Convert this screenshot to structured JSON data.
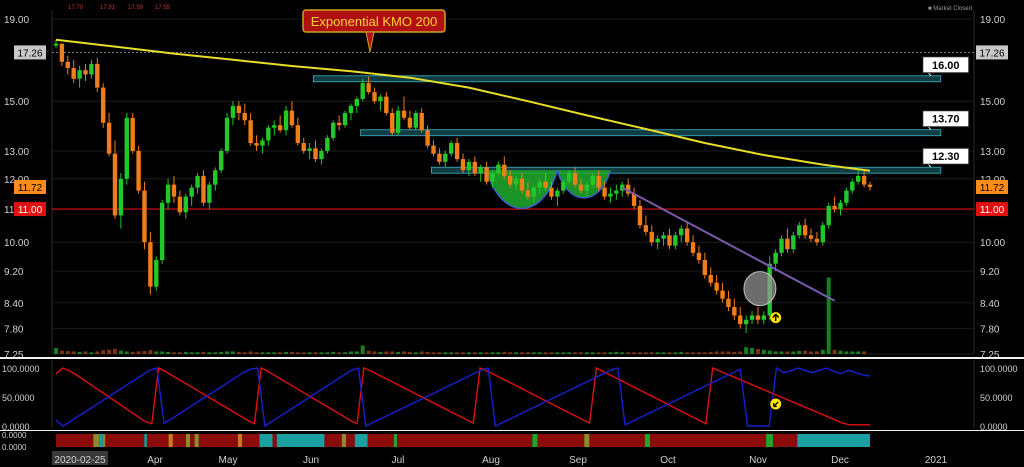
{
  "header": {
    "legend_values": [
      "17.70",
      "17.91",
      "17.59",
      "17.55"
    ],
    "market_status": "Market Closed"
  },
  "chart_data": {
    "type": "candlestick",
    "price_axis": {
      "ticks": [
        "19.00",
        "15.00",
        "13.00",
        "12.00",
        "11.00",
        "10.00",
        "9.20",
        "8.40",
        "7.80",
        "7.25"
      ],
      "scale": "log",
      "ylim": [
        7.25,
        19.5
      ]
    },
    "price_markers": [
      {
        "value": "17.26",
        "color": "#c8c8c8",
        "text_color": "#000000"
      },
      {
        "value": "11.72",
        "color": "#ff8c1a",
        "text_color": "#000000"
      },
      {
        "value": "11.00",
        "color": "#e01010",
        "text_color": "#ffffff"
      }
    ],
    "time_axis": [
      "2020-02-25",
      "Apr",
      "May",
      "Jun",
      "Jul",
      "Aug",
      "Sep",
      "Oct",
      "Nov",
      "Dec",
      "2021"
    ],
    "annotation": "Exponential KMO 200",
    "resistance_labels": [
      "16.00",
      "13.70",
      "12.30"
    ],
    "support_line": 11.0,
    "previous_close_line": 17.26,
    "colors": {
      "up": "#22c72a",
      "down": "#f07d1a",
      "kmo": "#e8de2a",
      "zone": "#1b6f7a",
      "cup": "#1fa32b"
    },
    "candles": [
      [
        17.6,
        17.9,
        17.5,
        17.7
      ],
      [
        17.7,
        17.7,
        16.6,
        16.8
      ],
      [
        16.8,
        17.1,
        16.2,
        16.5
      ],
      [
        16.5,
        16.9,
        15.8,
        16.0
      ],
      [
        16.0,
        16.6,
        15.6,
        16.4
      ],
      [
        16.4,
        16.7,
        15.9,
        16.2
      ],
      [
        16.2,
        16.9,
        16.0,
        16.7
      ],
      [
        16.7,
        17.0,
        15.4,
        15.6
      ],
      [
        15.6,
        15.8,
        13.9,
        14.1
      ],
      [
        14.1,
        14.5,
        12.8,
        12.9
      ],
      [
        12.9,
        13.4,
        10.7,
        10.8
      ],
      [
        10.8,
        12.2,
        10.4,
        12.0
      ],
      [
        12.0,
        14.5,
        11.8,
        14.3
      ],
      [
        14.3,
        14.5,
        12.9,
        13.0
      ],
      [
        13.0,
        13.2,
        11.5,
        11.6
      ],
      [
        11.6,
        11.9,
        9.8,
        10.0
      ],
      [
        10.0,
        10.3,
        8.6,
        8.8
      ],
      [
        8.8,
        9.6,
        8.7,
        9.5
      ],
      [
        9.5,
        11.3,
        9.4,
        11.2
      ],
      [
        11.2,
        12.0,
        11.0,
        11.8
      ],
      [
        11.8,
        12.1,
        11.2,
        11.4
      ],
      [
        11.4,
        11.6,
        10.8,
        10.9
      ],
      [
        10.9,
        11.5,
        10.7,
        11.4
      ],
      [
        11.4,
        11.8,
        11.1,
        11.7
      ],
      [
        11.7,
        12.2,
        11.5,
        12.1
      ],
      [
        12.1,
        12.3,
        11.1,
        11.2
      ],
      [
        11.2,
        11.9,
        11.0,
        11.8
      ],
      [
        11.8,
        12.4,
        11.6,
        12.3
      ],
      [
        12.3,
        13.1,
        12.2,
        13.0
      ],
      [
        13.0,
        14.5,
        12.9,
        14.3
      ],
      [
        14.3,
        15.0,
        14.0,
        14.8
      ],
      [
        14.8,
        15.0,
        14.2,
        14.5
      ],
      [
        14.5,
        14.9,
        14.0,
        14.2
      ],
      [
        14.2,
        14.5,
        13.2,
        13.3
      ],
      [
        13.3,
        13.6,
        13.0,
        13.2
      ],
      [
        13.2,
        13.5,
        12.9,
        13.4
      ],
      [
        13.4,
        14.0,
        13.2,
        13.9
      ],
      [
        13.9,
        14.2,
        13.6,
        14.0
      ],
      [
        14.0,
        14.4,
        13.7,
        13.8
      ],
      [
        13.8,
        14.8,
        13.6,
        14.6
      ],
      [
        14.6,
        15.0,
        13.9,
        14.0
      ],
      [
        14.0,
        14.3,
        13.2,
        13.3
      ],
      [
        13.3,
        13.5,
        12.9,
        13.0
      ],
      [
        13.0,
        13.3,
        12.7,
        13.1
      ],
      [
        13.1,
        13.4,
        12.6,
        12.7
      ],
      [
        12.7,
        13.1,
        12.5,
        13.0
      ],
      [
        13.0,
        13.6,
        12.9,
        13.5
      ],
      [
        13.5,
        14.2,
        13.4,
        14.1
      ],
      [
        14.1,
        14.4,
        13.8,
        14.0
      ],
      [
        14.0,
        14.6,
        13.9,
        14.5
      ],
      [
        14.5,
        14.9,
        14.2,
        14.8
      ],
      [
        14.8,
        15.2,
        14.5,
        15.1
      ],
      [
        15.1,
        16.0,
        15.0,
        15.8
      ],
      [
        15.8,
        16.1,
        15.3,
        15.4
      ],
      [
        15.4,
        15.6,
        14.9,
        15.0
      ],
      [
        15.0,
        15.3,
        14.6,
        15.2
      ],
      [
        15.2,
        15.4,
        14.4,
        14.5
      ],
      [
        14.5,
        14.7,
        13.6,
        13.7
      ],
      [
        13.7,
        14.8,
        13.6,
        14.6
      ],
      [
        14.6,
        15.2,
        14.2,
        14.3
      ],
      [
        14.3,
        14.6,
        13.8,
        13.9
      ],
      [
        13.9,
        14.6,
        13.8,
        14.5
      ],
      [
        14.5,
        14.7,
        13.7,
        13.8
      ],
      [
        13.8,
        14.0,
        13.1,
        13.2
      ],
      [
        13.2,
        13.4,
        12.8,
        12.9
      ],
      [
        12.9,
        13.1,
        12.5,
        12.6
      ],
      [
        12.6,
        13.0,
        12.4,
        12.9
      ],
      [
        12.9,
        13.4,
        12.8,
        13.3
      ],
      [
        13.3,
        13.5,
        12.6,
        12.7
      ],
      [
        12.7,
        12.9,
        12.2,
        12.3
      ],
      [
        12.3,
        12.7,
        12.1,
        12.6
      ],
      [
        12.6,
        12.8,
        12.1,
        12.2
      ],
      [
        12.2,
        12.5,
        11.9,
        12.4
      ],
      [
        12.4,
        12.6,
        11.8,
        11.9
      ],
      [
        11.9,
        12.3,
        11.7,
        12.2
      ],
      [
        12.2,
        12.6,
        12.1,
        12.5
      ],
      [
        12.5,
        12.8,
        12.0,
        12.1
      ],
      [
        12.1,
        12.3,
        11.7,
        11.8
      ],
      [
        11.8,
        12.1,
        11.6,
        12.0
      ],
      [
        12.0,
        12.2,
        11.5,
        11.6
      ],
      [
        11.6,
        11.9,
        11.3,
        11.4
      ],
      [
        11.4,
        11.8,
        11.2,
        11.7
      ],
      [
        11.7,
        12.0,
        11.5,
        11.9
      ],
      [
        11.9,
        12.2,
        11.6,
        11.7
      ],
      [
        11.7,
        11.9,
        11.3,
        11.4
      ],
      [
        11.4,
        11.7,
        11.1,
        11.6
      ],
      [
        11.6,
        12.0,
        11.5,
        11.9
      ],
      [
        11.9,
        12.3,
        11.8,
        12.2
      ],
      [
        12.2,
        12.4,
        11.7,
        11.8
      ],
      [
        11.8,
        12.0,
        11.5,
        11.6
      ],
      [
        11.6,
        11.9,
        11.4,
        11.8
      ],
      [
        11.8,
        12.2,
        11.7,
        12.1
      ],
      [
        12.1,
        12.3,
        11.6,
        11.7
      ],
      [
        11.7,
        11.9,
        11.3,
        11.4
      ],
      [
        11.4,
        11.7,
        11.2,
        11.5
      ],
      [
        11.5,
        11.8,
        11.3,
        11.6
      ],
      [
        11.6,
        11.9,
        11.4,
        11.8
      ],
      [
        11.8,
        12.0,
        11.4,
        11.5
      ],
      [
        11.5,
        11.7,
        11.0,
        11.1
      ],
      [
        11.1,
        11.3,
        10.4,
        10.5
      ],
      [
        10.5,
        10.8,
        10.2,
        10.3
      ],
      [
        10.3,
        10.5,
        9.9,
        10.0
      ],
      [
        10.0,
        10.2,
        9.8,
        10.1
      ],
      [
        10.1,
        10.3,
        9.9,
        10.2
      ],
      [
        10.2,
        10.4,
        9.8,
        9.9
      ],
      [
        9.9,
        10.3,
        9.8,
        10.2
      ],
      [
        10.2,
        10.5,
        10.0,
        10.4
      ],
      [
        10.4,
        10.6,
        9.9,
        10.0
      ],
      [
        10.0,
        10.2,
        9.6,
        9.7
      ],
      [
        9.7,
        9.9,
        9.4,
        9.5
      ],
      [
        9.5,
        9.7,
        9.0,
        9.1
      ],
      [
        9.1,
        9.3,
        8.8,
        8.9
      ],
      [
        8.9,
        9.1,
        8.6,
        8.7
      ],
      [
        8.7,
        8.9,
        8.4,
        8.5
      ],
      [
        8.5,
        8.7,
        8.2,
        8.3
      ],
      [
        8.3,
        8.5,
        8.0,
        8.1
      ],
      [
        8.1,
        8.3,
        7.8,
        7.9
      ],
      [
        7.9,
        8.1,
        7.7,
        8.0
      ],
      [
        8.0,
        8.2,
        7.9,
        8.1
      ],
      [
        8.1,
        8.3,
        7.9,
        8.0
      ],
      [
        8.0,
        8.2,
        7.9,
        8.1
      ],
      [
        8.1,
        9.6,
        8.0,
        9.4
      ],
      [
        9.4,
        9.8,
        9.2,
        9.7
      ],
      [
        9.7,
        10.2,
        9.6,
        10.1
      ],
      [
        10.1,
        10.4,
        9.7,
        9.8
      ],
      [
        9.8,
        10.3,
        9.7,
        10.2
      ],
      [
        10.2,
        10.6,
        10.1,
        10.5
      ],
      [
        10.5,
        10.7,
        10.1,
        10.2
      ],
      [
        10.2,
        10.4,
        10.0,
        10.1
      ],
      [
        10.1,
        10.3,
        9.9,
        10.0
      ],
      [
        10.0,
        10.6,
        9.9,
        10.5
      ],
      [
        10.5,
        11.2,
        10.4,
        11.1
      ],
      [
        11.1,
        11.4,
        10.9,
        11.0
      ],
      [
        11.0,
        11.3,
        10.8,
        11.2
      ],
      [
        11.2,
        11.7,
        11.1,
        11.6
      ],
      [
        11.6,
        12.0,
        11.5,
        11.9
      ],
      [
        11.9,
        12.3,
        11.8,
        12.1
      ],
      [
        12.1,
        12.3,
        11.7,
        11.8
      ],
      [
        11.8,
        11.9,
        11.6,
        11.72
      ]
    ],
    "volume": [
      0.7,
      0.4,
      0.35,
      0.3,
      0.25,
      0.3,
      0.2,
      0.3,
      0.45,
      0.5,
      0.6,
      0.4,
      0.3,
      0.25,
      0.3,
      0.35,
      0.45,
      0.3,
      0.3,
      0.25,
      0.2,
      0.2,
      0.25,
      0.2,
      0.2,
      0.25,
      0.2,
      0.2,
      0.25,
      0.3,
      0.3,
      0.25,
      0.2,
      0.3,
      0.2,
      0.2,
      0.2,
      0.2,
      0.2,
      0.25,
      0.25,
      0.2,
      0.2,
      0.2,
      0.2,
      0.2,
      0.2,
      0.25,
      0.2,
      0.2,
      0.3,
      0.3,
      1.0,
      0.4,
      0.3,
      0.25,
      0.3,
      0.3,
      0.25,
      0.3,
      0.25,
      0.2,
      0.3,
      0.25,
      0.2,
      0.2,
      0.2,
      0.2,
      0.2,
      0.2,
      0.2,
      0.2,
      0.2,
      0.2,
      0.2,
      0.2,
      0.25,
      0.2,
      0.2,
      0.2,
      0.2,
      0.2,
      0.2,
      0.2,
      0.2,
      0.2,
      0.2,
      0.2,
      0.2,
      0.2,
      0.2,
      0.2,
      0.2,
      0.2,
      0.2,
      0.25,
      0.2,
      0.2,
      0.2,
      0.2,
      0.2,
      0.2,
      0.2,
      0.2,
      0.2,
      0.2,
      0.25,
      0.2,
      0.2,
      0.2,
      0.2,
      0.25,
      0.3,
      0.3,
      0.3,
      0.25,
      0.3,
      0.8,
      0.7,
      0.6,
      0.5,
      0.4,
      0.3,
      0.3,
      0.3,
      0.3,
      0.35,
      0.4,
      0.3,
      0.3,
      0.5,
      9.0,
      0.5,
      0.4,
      0.3,
      0.3,
      0.3,
      0.3
    ],
    "oscillator": {
      "ticks": [
        "100.0000",
        "50.0000",
        "0.0000"
      ],
      "series": [
        {
          "color": "#e01010",
          "values": [
            90,
            100,
            95,
            88,
            80,
            72,
            64,
            56,
            48,
            40,
            32,
            24,
            16,
            8,
            4,
            100,
            94,
            87,
            80,
            73,
            66,
            59,
            52,
            45,
            38,
            31,
            24,
            17,
            10,
            4,
            100,
            94,
            87,
            80,
            73,
            66,
            59,
            52,
            45,
            38,
            31,
            24,
            17,
            10,
            4,
            100,
            95,
            89,
            83,
            77,
            71,
            65,
            59,
            53,
            47,
            41,
            35,
            29,
            23,
            17,
            11,
            5,
            100,
            95,
            89,
            83,
            77,
            71,
            65,
            59,
            53,
            47,
            41,
            35,
            29,
            23,
            17,
            11,
            5,
            100,
            94,
            88,
            82,
            76,
            70,
            64,
            58,
            52,
            46,
            40,
            34,
            28,
            22,
            16,
            10,
            4,
            100,
            95,
            90,
            85,
            80,
            75,
            70,
            65,
            60,
            55,
            50,
            45,
            40,
            35,
            30,
            25,
            20,
            15,
            10,
            5,
            2,
            2,
            2,
            2
          ]
        },
        {
          "color": "#1820d0",
          "values": [
            10,
            0,
            8,
            16,
            24,
            32,
            40,
            48,
            56,
            64,
            72,
            80,
            88,
            96,
            100,
            5,
            12,
            20,
            28,
            36,
            44,
            52,
            60,
            68,
            76,
            84,
            92,
            98,
            100,
            0,
            8,
            16,
            24,
            32,
            40,
            48,
            56,
            64,
            72,
            80,
            88,
            96,
            100,
            0,
            6,
            12,
            18,
            24,
            30,
            36,
            42,
            48,
            54,
            60,
            66,
            72,
            78,
            84,
            90,
            96,
            100,
            0,
            6,
            12,
            18,
            24,
            30,
            36,
            42,
            48,
            54,
            60,
            66,
            72,
            78,
            84,
            90,
            96,
            100,
            2,
            8,
            14,
            20,
            26,
            32,
            38,
            44,
            50,
            56,
            62,
            68,
            74,
            80,
            86,
            92,
            98,
            0,
            0,
            0,
            0,
            100,
            92,
            95,
            100,
            96,
            92,
            96,
            100,
            94,
            90,
            96,
            92,
            88,
            86
          ]
        }
      ]
    },
    "ribbon_ticks": [
      "0.0000",
      "0.0000"
    ],
    "ribbon_segments": [
      [
        "#8b0a0a",
        0,
        0.43
      ],
      [
        "#8b8b2a",
        0.43,
        0.5
      ],
      [
        "#1aa0a0",
        0.5,
        0.54
      ],
      [
        "#8b8b2a",
        0.54,
        0.57
      ],
      [
        "#8b0a0a",
        0.57,
        1.02
      ],
      [
        "#1aa0a0",
        1.02,
        1.05
      ],
      [
        "#8b0a0a",
        1.05,
        1.3
      ],
      [
        "#c87a1a",
        1.3,
        1.35
      ],
      [
        "#8b0a0a",
        1.35,
        1.5
      ],
      [
        "#8b8b2a",
        1.5,
        1.55
      ],
      [
        "#8b0a0a",
        1.55,
        1.6
      ],
      [
        "#8b8b2a",
        1.6,
        1.65
      ],
      [
        "#8b0a0a",
        1.65,
        2.1
      ],
      [
        "#c87a1a",
        2.1,
        2.15
      ],
      [
        "#8b0a0a",
        2.15,
        2.35
      ],
      [
        "#1aa0a0",
        2.35,
        2.5
      ],
      [
        "#8b0a0a",
        2.5,
        2.55
      ],
      [
        "#1aa0a0",
        2.55,
        3.1
      ],
      [
        "#8b0a0a",
        3.1,
        3.3
      ],
      [
        "#8b8b2a",
        3.3,
        3.35
      ],
      [
        "#8b0a0a",
        3.35,
        3.45
      ],
      [
        "#1aa0a0",
        3.45,
        3.6
      ],
      [
        "#8b0a0a",
        3.6,
        3.9
      ],
      [
        "#1fa32b",
        3.9,
        3.94
      ],
      [
        "#8b0a0a",
        3.94,
        5.5
      ],
      [
        "#1fa32b",
        5.5,
        5.56
      ],
      [
        "#8b0a0a",
        5.56,
        6.1
      ],
      [
        "#8b8b2a",
        6.1,
        6.16
      ],
      [
        "#8b0a0a",
        6.16,
        6.8
      ],
      [
        "#1fa32b",
        6.8,
        6.86
      ],
      [
        "#8b0a0a",
        6.86,
        8.2
      ],
      [
        "#1fa32b",
        8.2,
        8.28
      ],
      [
        "#8b0a0a",
        8.28,
        8.56
      ],
      [
        "#1aa0a0",
        8.56,
        9.4
      ]
    ]
  }
}
